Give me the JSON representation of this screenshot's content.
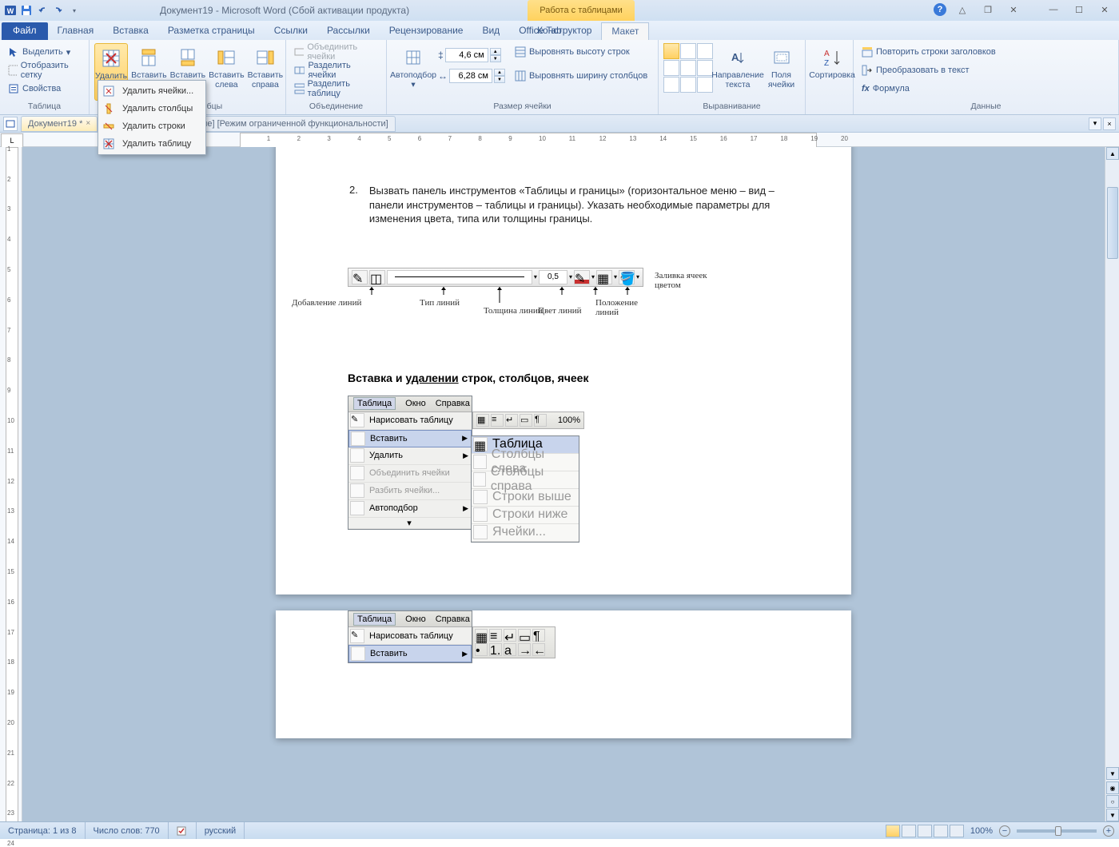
{
  "title": "Документ19 - Microsoft Word (Сбой активации продукта)",
  "context_tab": "Работа с таблицами",
  "tabs": {
    "file": "Файл",
    "home": "Главная",
    "insert": "Вставка",
    "layout": "Разметка страницы",
    "refs": "Ссылки",
    "mail": "Рассылки",
    "review": "Рецензирование",
    "view": "Вид",
    "officetab": "Office Tab",
    "design": "Конструктор",
    "tlayout": "Макет"
  },
  "ribbon": {
    "g_table": {
      "label": "Таблица",
      "select": "Выделить",
      "grid": "Отобразить сетку",
      "props": "Свойства"
    },
    "g_rowscols": {
      "label": "Строки и столбцы",
      "delete": "Удалить",
      "ins_above": "Вставить сверху",
      "ins_below": "Вставить снизу",
      "ins_left": "Вставить слева",
      "ins_right": "Вставить справа"
    },
    "g_merge": {
      "label": "Объединение",
      "merge": "Объединить ячейки",
      "split_cells": "Разделить ячейки",
      "split_table": "Разделить таблицу"
    },
    "g_cellsize": {
      "label": "Размер ячейки",
      "autofit": "Автоподбор",
      "height": "4,6 см",
      "width": "6,28 см",
      "dist_rows": "Выровнять высоту строк",
      "dist_cols": "Выровнять ширину столбцов"
    },
    "g_align": {
      "label": "Выравнивание",
      "textdir": "Направление текста",
      "margins": "Поля ячейки"
    },
    "g_data": {
      "label": "Данные",
      "sort": "Сортировка",
      "repeat": "Повторить строки заголовков",
      "convert": "Преобразовать в текст",
      "formula": "Формула"
    }
  },
  "delete_menu": {
    "cells": "Удалить ячейки...",
    "cols": "Удалить столбцы",
    "rows": "Удалить строки",
    "table": "Удалить таблицу"
  },
  "doc_tabs": {
    "active": "Документ19 *",
    "inactive_suffix": "аботы.doc [только чтение] [Режим ограниченной функциональности]"
  },
  "content": {
    "item2": "Вызвать панель инструментов «Таблицы и границы» (горизонтальное меню – вид – панели инструментов – таблицы и границы). Указать необходимые параметры для изменения цвета, типа или толщины границы.",
    "diag_addlines": "Добавление линий",
    "diag_linetype": "Тип линий",
    "diag_thickness": "Толщина линий",
    "diag_linecolor": "Цвет линий",
    "diag_linepos": "Положение линий",
    "diag_fill": "Заливка ячеек цветом",
    "diag_weight": "0,5",
    "heading": {
      "pre": "Вставка и ",
      "ul": "удалении",
      "post": " строк, столбцов, ячеек"
    },
    "menu": {
      "top": [
        "Таблица",
        "Окно",
        "Справка"
      ],
      "draw": "Нарисовать таблицу",
      "insert": "Вставить",
      "delete": "Удалить",
      "merge": "Объединить ячейки",
      "split": "Разбить ячейки...",
      "autofit": "Автоподбор",
      "sub": {
        "table": "Таблица",
        "cols_left": "Столбцы слева",
        "cols_right": "Столбцы справа",
        "rows_above": "Строки выше",
        "rows_below": "Строки ниже",
        "cells": "Ячейки..."
      },
      "zoom": "100%"
    }
  },
  "status": {
    "page": "Страница: 1 из 8",
    "words": "Число слов: 770",
    "lang": "русский",
    "zoom": "100%"
  }
}
